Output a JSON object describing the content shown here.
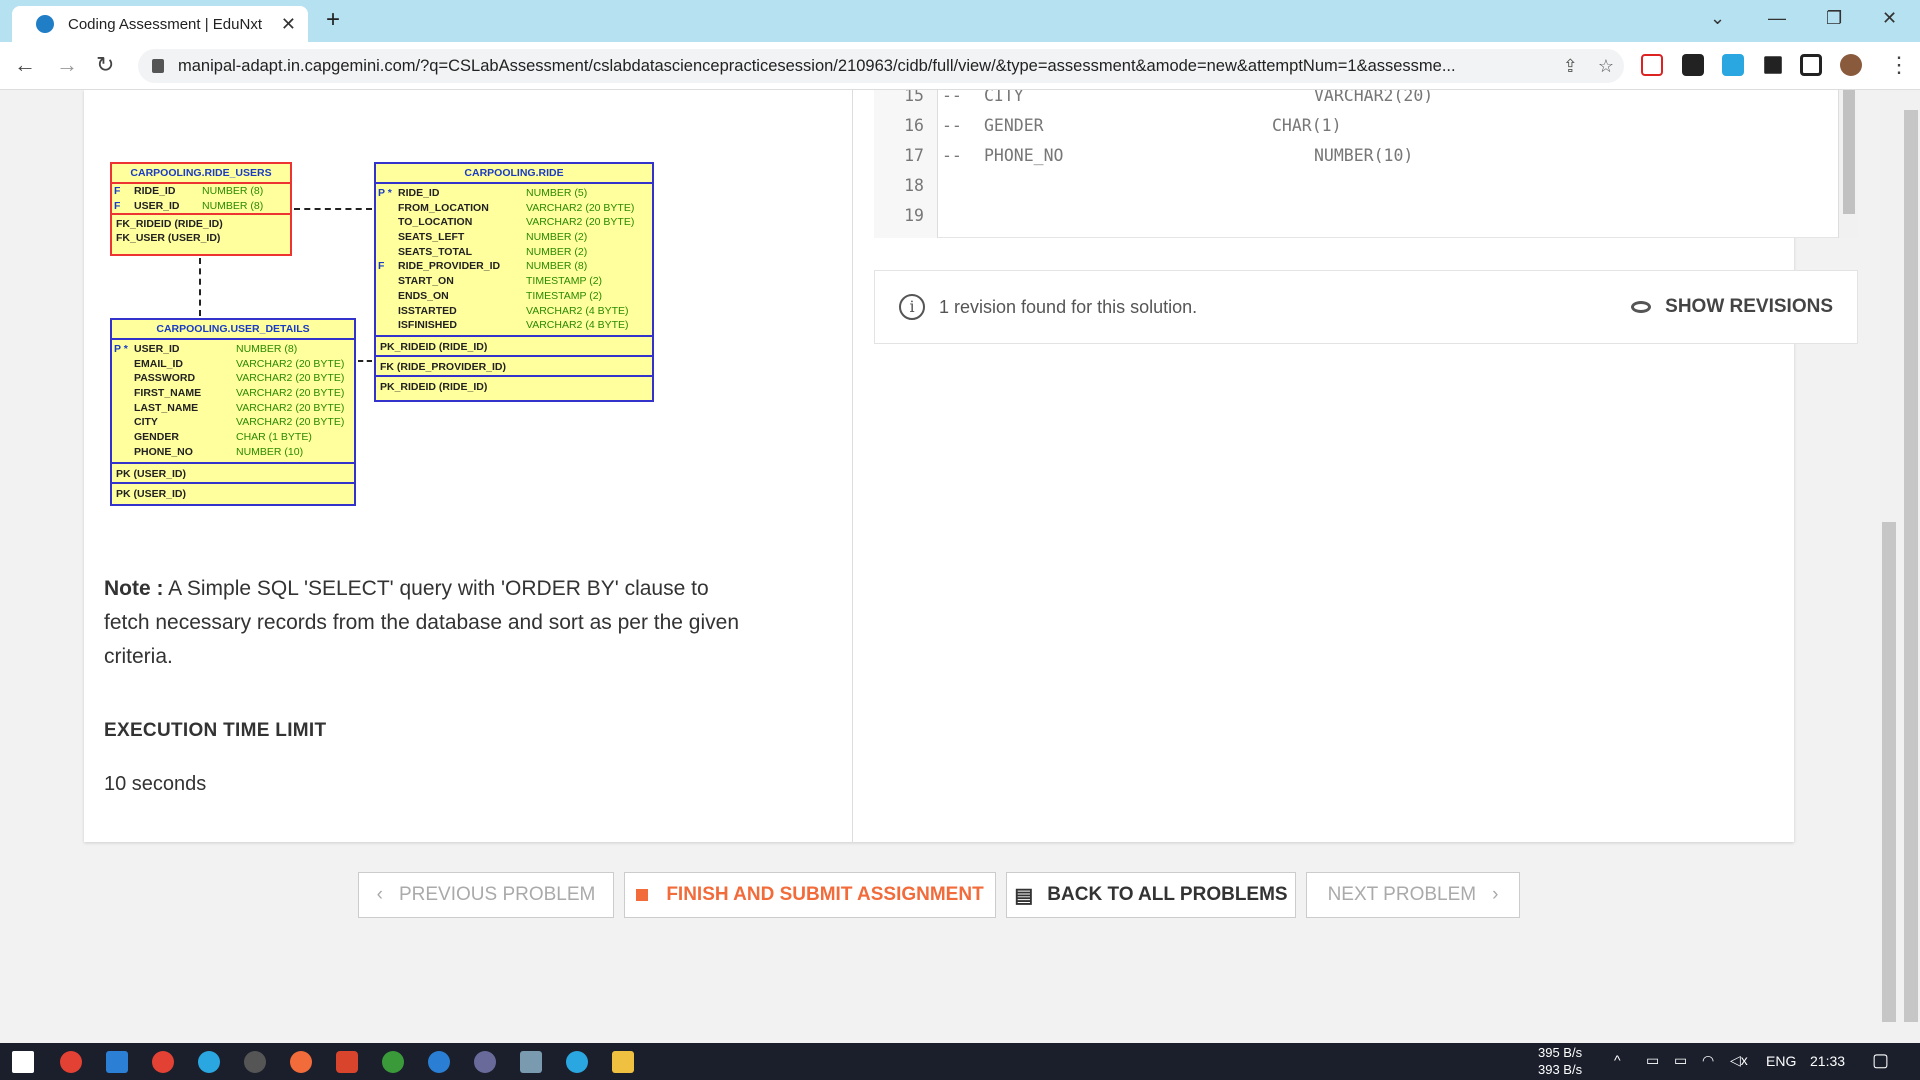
{
  "browser": {
    "tab_title": "Coding Assessment | EduNxt",
    "url": "manipal-adapt.in.capgemini.com/?q=CSLabAssessment/cslabdatasciencepracticesession/210963/cidb/full/view/&type=assessment&amode=new&attemptNum=1&assessme..."
  },
  "diagram": {
    "ride_users": {
      "title": "CARPOOLING.RIDE_USERS",
      "rows": [
        {
          "key": "F",
          "col": "RIDE_ID",
          "type": "NUMBER (8)"
        },
        {
          "key": "F",
          "col": "USER_ID",
          "type": "NUMBER (8)"
        }
      ],
      "fks": [
        "FK_RIDEID (RIDE_ID)",
        "FK_USER (USER_ID)"
      ]
    },
    "ride": {
      "title": "CARPOOLING.RIDE",
      "rows": [
        {
          "key": "P *",
          "col": "RIDE_ID",
          "type": "NUMBER (5)"
        },
        {
          "key": "",
          "col": "FROM_LOCATION",
          "type": "VARCHAR2 (20 BYTE)"
        },
        {
          "key": "",
          "col": "TO_LOCATION",
          "type": "VARCHAR2 (20 BYTE)"
        },
        {
          "key": "",
          "col": "SEATS_LEFT",
          "type": "NUMBER (2)"
        },
        {
          "key": "",
          "col": "SEATS_TOTAL",
          "type": "NUMBER (2)"
        },
        {
          "key": "F",
          "col": "RIDE_PROVIDER_ID",
          "type": "NUMBER (8)"
        },
        {
          "key": "",
          "col": "START_ON",
          "type": "TIMESTAMP (2)"
        },
        {
          "key": "",
          "col": "ENDS_ON",
          "type": "TIMESTAMP (2)"
        },
        {
          "key": "",
          "col": "ISSTARTED",
          "type": "VARCHAR2 (4 BYTE)"
        },
        {
          "key": "",
          "col": "ISFINISHED",
          "type": "VARCHAR2 (4 BYTE)"
        }
      ],
      "pk": "PK_RIDEID (RIDE_ID)",
      "fk": "FK (RIDE_PROVIDER_ID)",
      "idx": "PK_RIDEID (RIDE_ID)"
    },
    "user_details": {
      "title": "CARPOOLING.USER_DETAILS",
      "rows": [
        {
          "key": "P *",
          "col": "USER_ID",
          "type": "NUMBER (8)"
        },
        {
          "key": "",
          "col": "EMAIL_ID",
          "type": "VARCHAR2 (20 BYTE)"
        },
        {
          "key": "",
          "col": "PASSWORD",
          "type": "VARCHAR2 (20 BYTE)"
        },
        {
          "key": "",
          "col": "FIRST_NAME",
          "type": "VARCHAR2 (20 BYTE)"
        },
        {
          "key": "",
          "col": "LAST_NAME",
          "type": "VARCHAR2 (20 BYTE)"
        },
        {
          "key": "",
          "col": "CITY",
          "type": "VARCHAR2 (20 BYTE)"
        },
        {
          "key": "",
          "col": "GENDER",
          "type": "CHAR (1 BYTE)"
        },
        {
          "key": "",
          "col": "PHONE_NO",
          "type": "NUMBER (10)"
        }
      ],
      "pk": "PK (USER_ID)",
      "idx": "PK (USER_ID)"
    }
  },
  "note": {
    "label": "Note :",
    "text": " A Simple SQL 'SELECT' query with 'ORDER BY' clause to fetch necessary records from the database and sort as per the given criteria."
  },
  "execution": {
    "heading": "EXECUTION TIME LIMIT",
    "value": "10 seconds"
  },
  "code_lines": [
    {
      "num": "15",
      "dash": "--",
      "name": "CITY",
      "type": "VARCHAR2(20)"
    },
    {
      "num": "16",
      "dash": "--",
      "name": "GENDER",
      "type": "CHAR(1)"
    },
    {
      "num": "17",
      "dash": "--",
      "name": "PHONE_NO",
      "type": "NUMBER(10)"
    },
    {
      "num": "18",
      "dash": "",
      "name": "",
      "type": ""
    },
    {
      "num": "19",
      "dash": "",
      "name": "",
      "type": ""
    }
  ],
  "revisions": {
    "text": "1 revision found for this solution.",
    "button": "SHOW REVISIONS"
  },
  "nav_buttons": {
    "prev": "PREVIOUS PROBLEM",
    "finish": "FINISH AND SUBMIT ASSIGNMENT",
    "back": "BACK TO ALL PROBLEMS",
    "next": "NEXT PROBLEM"
  },
  "taskbar": {
    "net_up": "395 B/s",
    "net_down": "393 B/s",
    "lang": "ENG",
    "time": "21:33"
  }
}
